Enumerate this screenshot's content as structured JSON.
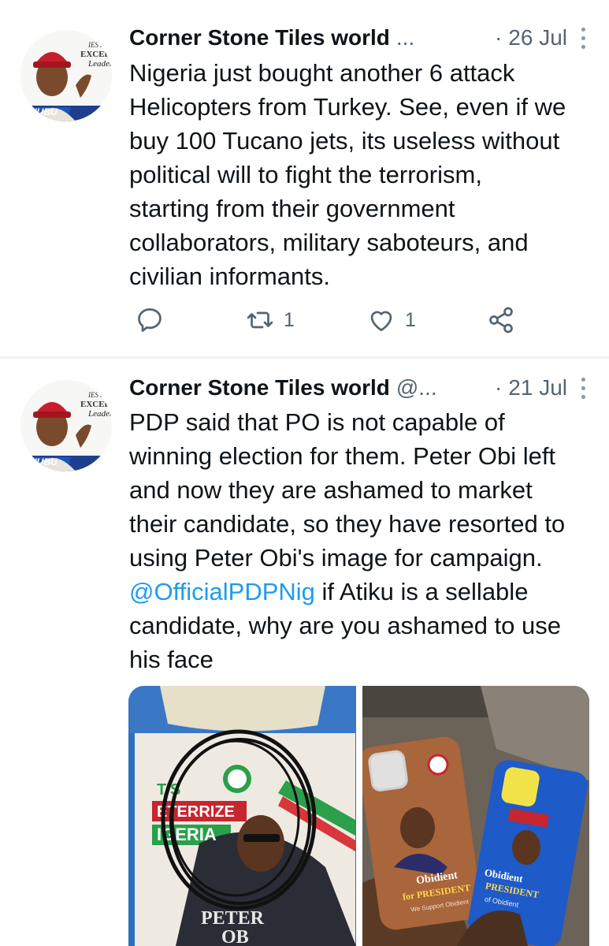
{
  "tweets": [
    {
      "author_name": "Corner Stone Tiles world",
      "handle": "...",
      "date": "26 Jul",
      "text_lines": [
        "Nigeria just bought another 6 attack",
        "Helicopters from Turkey. See, even if we",
        "buy 100 Tucano jets, its useless without",
        "political will to fight the terrorism,",
        "starting from their government",
        "collaborators, military saboteurs, and",
        "civilian informants."
      ],
      "actions": {
        "reply_icon": "reply-icon",
        "retweet_icon": "retweet-icon",
        "retweet_count": "1",
        "like_icon": "heart-icon",
        "like_count": "1",
        "share_icon": "share-icon"
      }
    },
    {
      "author_name": "Corner Stone Tiles world",
      "handle": "@...",
      "date": "21 Jul",
      "text_lines": [
        "PDP said that PO is not capable of",
        "winning election for them. Peter Obi left",
        "and now they are ashamed to market",
        "their candidate, so they have resorted to",
        "using Peter Obi's image for campaign."
      ],
      "mention": "@OfficialPDPNig",
      "text_after_mention": " if Atiku is a sellable",
      "text_lines_after": [
        "candidate, why are you ashamed to use",
        "his face"
      ],
      "media": {
        "left_image_text": [
          "T'S",
          "ETERRIZE",
          "IGERIA",
          "PETER",
          "OB"
        ],
        "right_image_text": [
          "Obidient",
          "for PRESIDENT",
          "We Support Obidient",
          "Obidient",
          "PRESIDENT",
          "of Obidient"
        ]
      }
    }
  ],
  "avatar": {
    "text_top": "EXCEL",
    "text_mid": "Leader",
    "text_banner": "NUBU"
  },
  "colors": {
    "text": "#0f1419",
    "secondary": "#536471",
    "link": "#1d9bf0",
    "divider": "#eff3f4"
  }
}
